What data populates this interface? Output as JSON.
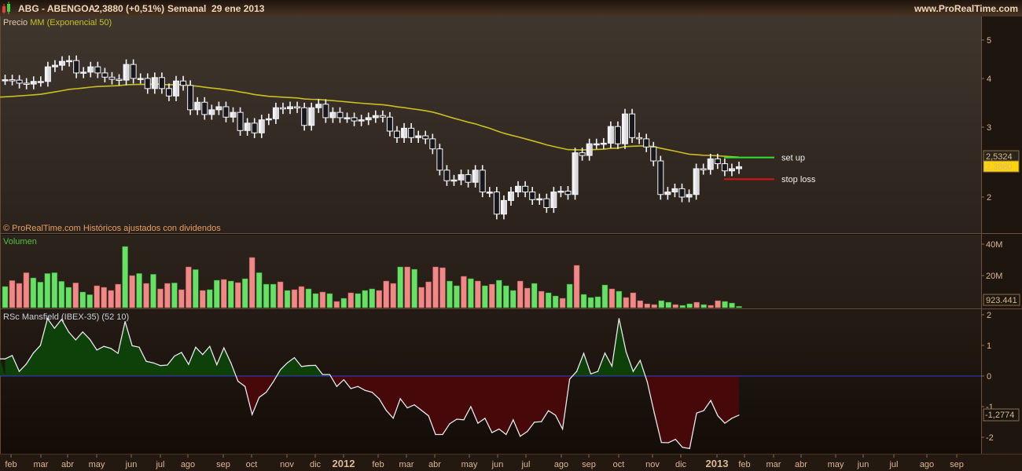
{
  "header": {
    "symbol": "ABG - ABENGOA",
    "quote": "2,3880 (+0,51%)",
    "period": "Semanal  29 ene 2013",
    "site": "www.ProRealTime.com"
  },
  "price_panel": {
    "label_prefix": "Precio",
    "label_indicator": "MM (Exponencial 50)",
    "footer": "© ProRealTime.com  Históricos ajustados con dividendos",
    "axis_labels": [
      "5",
      "4",
      "3",
      "2"
    ],
    "ema_value": "2,5324",
    "last_price": "2,3880",
    "annotations": {
      "setup": "set up",
      "stoploss": "stop loss"
    }
  },
  "volume_panel": {
    "label": "Volumen",
    "axis_labels": [
      "40M",
      "20M"
    ],
    "last_value": "923.441"
  },
  "rsc_panel": {
    "label": "RSc Mansfield (IBEX-35) (52 10)",
    "axis_labels": [
      "2",
      "1",
      "0",
      "-1",
      "-2"
    ],
    "last_value": "-1,2774"
  },
  "x_axis": {
    "labels": [
      "feb",
      "mar",
      "abr",
      "may",
      "jun",
      "jul",
      "ago",
      "sep",
      "oct",
      "nov",
      "dic",
      "2012",
      "feb",
      "mar",
      "abr",
      "may",
      "jun",
      "jul",
      "ago",
      "sep",
      "oct",
      "nov",
      "dic",
      "2013",
      "feb",
      "mar",
      "abr",
      "may",
      "jun",
      "jul",
      "ago",
      "sep"
    ]
  },
  "colors": {
    "up_volume": "#66e066",
    "down_volume": "#f08888",
    "ema": "#c8c020",
    "setup_line": "#30e030",
    "stoploss_line": "#e01010",
    "rsc_positive": "#0e400a",
    "rsc_negative": "#460808",
    "zero_line": "#3a3ad0"
  },
  "chart_data": [
    {
      "type": "candlestick",
      "title": "ABG - ABENGOA (Semanal)",
      "scale": "log",
      "ylim": [
        1.7,
        5.4
      ],
      "x_range": [
        "feb 2011",
        "ene 2013"
      ],
      "ema_period": 50,
      "ema_seed": 3.57,
      "ema_last": 2.5324,
      "close": [
        3.97,
        3.96,
        3.89,
        3.87,
        3.93,
        3.93,
        4.28,
        4.32,
        4.42,
        4.44,
        4.13,
        4.15,
        4.28,
        4.13,
        4.03,
        3.98,
        3.96,
        4.34,
        4.0,
        4.0,
        3.77,
        4.02,
        3.77,
        3.61,
        3.94,
        3.84,
        3.33,
        3.48,
        3.24,
        3.33,
        3.39,
        3.19,
        3.28,
        2.95,
        3.08,
        2.91,
        3.14,
        3.16,
        3.37,
        3.35,
        3.39,
        3.37,
        3.04,
        3.37,
        3.44,
        3.18,
        3.28,
        3.18,
        3.18,
        3.12,
        3.14,
        3.18,
        3.22,
        3.19,
        2.94,
        2.83,
        2.99,
        2.83,
        2.86,
        2.81,
        2.65,
        2.34,
        2.2,
        2.21,
        2.28,
        2.18,
        2.34,
        2.06,
        2.06,
        1.81,
        1.96,
        2.06,
        2.13,
        2.06,
        1.97,
        1.98,
        1.88,
        2.06,
        2.07,
        2.03,
        2.59,
        2.55,
        2.73,
        2.73,
        2.74,
        3.02,
        2.73,
        3.25,
        2.83,
        2.81,
        2.68,
        2.47,
        2.03,
        2.06,
        2.1,
        2.0,
        2.03,
        2.36,
        2.35,
        2.5,
        2.43,
        2.33,
        2.36,
        2.388
      ],
      "levels": [
        {
          "name": "set up",
          "value": 2.52
        },
        {
          "name": "stop loss",
          "value": 2.22
        }
      ]
    },
    {
      "type": "bar",
      "title": "Volumen",
      "ylabel": "M",
      "ylim": [
        0,
        45
      ],
      "values": [
        13.5,
        17.3,
        15.5,
        22.3,
        19,
        16.3,
        21.8,
        22.3,
        16.8,
        13,
        15.8,
        10,
        8.3,
        14,
        13,
        11,
        15,
        39,
        20.5,
        21.8,
        15.5,
        21.3,
        12,
        15.5,
        15.8,
        11.5,
        26,
        24.3,
        11,
        11.5,
        17.5,
        18,
        17,
        16,
        18.5,
        32,
        22.3,
        15,
        15,
        16.5,
        11,
        11.5,
        13.5,
        12,
        9,
        10,
        9,
        4,
        6,
        9.5,
        9,
        11,
        12,
        11,
        17,
        15.5,
        26,
        26,
        24.5,
        13,
        16.5,
        26,
        25.5,
        17,
        14,
        20,
        18.5,
        17,
        14,
        15,
        17.5,
        14,
        11,
        17,
        12.5,
        15.5,
        10.5,
        9.5,
        7.5,
        6,
        15,
        27,
        8.5,
        6.5,
        7,
        14.5,
        12,
        10.5,
        6.5,
        9.5,
        4.5,
        2.5,
        2,
        4.5,
        3.5,
        2,
        1.5,
        2.5,
        3.5,
        2,
        1.5,
        4.5,
        4,
        3,
        0.92
      ]
    },
    {
      "type": "area",
      "title": "RSc Mansfield (IBEX-35) (52 10)",
      "ylim": [
        -2.6,
        2.2
      ],
      "values": [
        0.56,
        0.67,
        0.15,
        0.39,
        0.75,
        1.0,
        1.88,
        1.56,
        1.85,
        1.44,
        1.18,
        1.44,
        1.2,
        0.85,
        0.97,
        0.9,
        0.74,
        1.78,
        0.99,
        0.94,
        0.48,
        0.43,
        0.34,
        0.36,
        0.65,
        0.77,
        0.38,
        0.94,
        0.7,
        0.97,
        0.37,
        0.92,
        0.43,
        -0.17,
        -0.34,
        -1.26,
        -0.7,
        -0.53,
        -0.19,
        0.2,
        0.43,
        0.6,
        0.31,
        0.34,
        0.35,
        0.05,
        0.05,
        -0.34,
        -0.12,
        -0.41,
        -0.34,
        -0.47,
        -0.53,
        -0.74,
        -1.12,
        -1.38,
        -0.74,
        -1.04,
        -0.94,
        -1.12,
        -1.3,
        -1.91,
        -1.91,
        -1.56,
        -1.41,
        -1.43,
        -1.0,
        -1.54,
        -1.38,
        -1.85,
        -1.73,
        -1.91,
        -1.43,
        -1.97,
        -1.81,
        -1.51,
        -1.49,
        -1.13,
        -1.28,
        -1.73,
        -0.1,
        0.15,
        0.74,
        0.07,
        0.15,
        0.75,
        0.32,
        1.88,
        0.79,
        0.15,
        0.51,
        -0.19,
        -1.21,
        -2.17,
        -2.18,
        -2.07,
        -2.33,
        -2.37,
        -1.21,
        -1.13,
        -0.8,
        -1.3,
        -1.54,
        -1.38,
        -1.2774
      ]
    }
  ]
}
